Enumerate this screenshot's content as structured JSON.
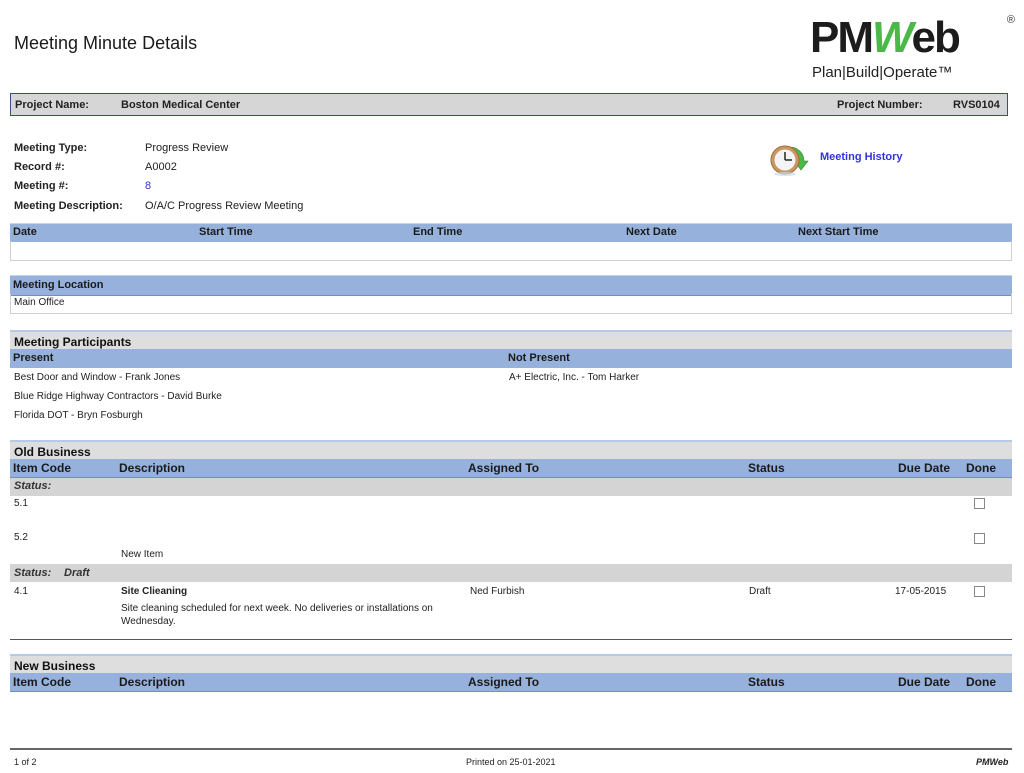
{
  "page": {
    "title": "Meeting Minute Details"
  },
  "logo": {
    "brand_pm": "PM",
    "brand_w": "W",
    "brand_eb": "eb",
    "registered": "®",
    "tagline": "Plan|Build|Operate™",
    "colors": {
      "dark": "#1c1c1c",
      "green": "#4cb848"
    }
  },
  "project": {
    "name_label": "Project Name:",
    "name_value": "Boston Medical Center",
    "number_label": "Project Number:",
    "number_value": "RVS0104"
  },
  "meeting": {
    "type_label": "Meeting Type:",
    "type_value": "Progress Review",
    "record_label": "Record #:",
    "record_value": "A0002",
    "number_label": "Meeting #:",
    "number_value": "8",
    "description_label": "Meeting Description:",
    "description_value": "O/A/C Progress Review Meeting",
    "history_link": "Meeting History",
    "history_icon": "clock-history-icon"
  },
  "schedule": {
    "headers": [
      "Date",
      "Start Time",
      "End Time",
      "Next Date",
      "Next Start Time"
    ],
    "values": [
      "",
      "",
      "",
      "",
      ""
    ]
  },
  "location": {
    "header": "Meeting Location",
    "value": "Main Office"
  },
  "participants": {
    "section_title": "Meeting Participants",
    "present_header": "Present",
    "not_present_header": "Not Present",
    "present": [
      "Best Door and Window - Frank Jones",
      "Blue Ridge Highway Contractors - David  Burke",
      "Florida DOT - Bryn Fosburgh"
    ],
    "not_present": [
      "A+ Electric, Inc. - Tom Harker"
    ]
  },
  "old_business": {
    "section_title": "Old Business",
    "columns": [
      "Item Code",
      "Description",
      "Assigned To",
      "Status",
      "Due Date",
      "Done"
    ],
    "groups": [
      {
        "status_label": "Status:",
        "status_value": "",
        "items": [
          {
            "code": "5.1",
            "title": "",
            "description": "",
            "assigned_to": "",
            "status": "",
            "due_date": "",
            "done": false
          },
          {
            "code": "5.2",
            "title": "",
            "description": "New Item",
            "assigned_to": "",
            "status": "",
            "due_date": "",
            "done": false
          }
        ]
      },
      {
        "status_label": "Status:",
        "status_value": "Draft",
        "items": [
          {
            "code": "4.1",
            "title": "Site Clieaning",
            "description": "Site cleaning scheduled for next week.  No deliveries or installations on Wednesday.",
            "assigned_to": "Ned Furbish",
            "status": "Draft",
            "due_date": "17-05-2015",
            "done": false
          }
        ]
      }
    ]
  },
  "new_business": {
    "section_title": "New Business",
    "columns": [
      "Item Code",
      "Description",
      "Assigned To",
      "Status",
      "Due Date",
      "Done"
    ]
  },
  "footer": {
    "page": "1 of 2",
    "printed": "Printed on 25-01-2021",
    "brand": "PMWeb"
  },
  "colors": {
    "header_blue": "#96b1dc",
    "section_gray": "#dedede",
    "status_gray": "#d4d4d4",
    "link_blue": "#3333dd"
  }
}
